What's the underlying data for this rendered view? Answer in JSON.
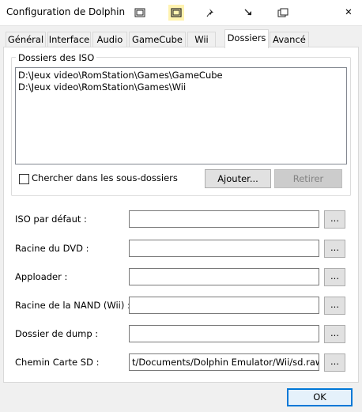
{
  "window": {
    "title": "Configuration de Dolphin",
    "close_glyph": "✕",
    "titlebar_icons": [
      "window-icon",
      "window-highlighted-icon",
      "pin-icon",
      "collapse-arrow-icon",
      "window-tile-icon"
    ]
  },
  "tabs": [
    {
      "label": "Général",
      "active": false
    },
    {
      "label": "Interface",
      "active": false
    },
    {
      "label": "Audio",
      "active": false
    },
    {
      "label": "GameCube",
      "active": false
    },
    {
      "label": "Wii",
      "active": false
    },
    {
      "label": "Dossiers",
      "active": true
    },
    {
      "label": "Avancé",
      "active": false
    }
  ],
  "iso_group": {
    "title": "Dossiers des ISO",
    "paths": [
      "D:\\Jeux video\\RomStation\\Games\\GameCube",
      "D:\\Jeux video\\RomStation\\Games\\Wii"
    ],
    "recursive_label": "Chercher dans les sous-dossiers",
    "recursive_checked": false,
    "add_label": "Ajouter...",
    "remove_label": "Retirer"
  },
  "fields": [
    {
      "label": "ISO par défaut :",
      "value": ""
    },
    {
      "label": "Racine du DVD :",
      "value": ""
    },
    {
      "label": "Apploader :",
      "value": ""
    },
    {
      "label": "Racine de la NAND (Wii) :",
      "value": ""
    },
    {
      "label": "Dossier de dump :",
      "value": ""
    },
    {
      "label": "Chemin Carte SD :",
      "value": "t/Documents/Dolphin Emulator/Wii/sd.raw"
    }
  ],
  "browse_label": "...",
  "ok_label": "OK",
  "colors": {
    "accent": "#0078d7",
    "disabled_button": "#cccccc"
  }
}
